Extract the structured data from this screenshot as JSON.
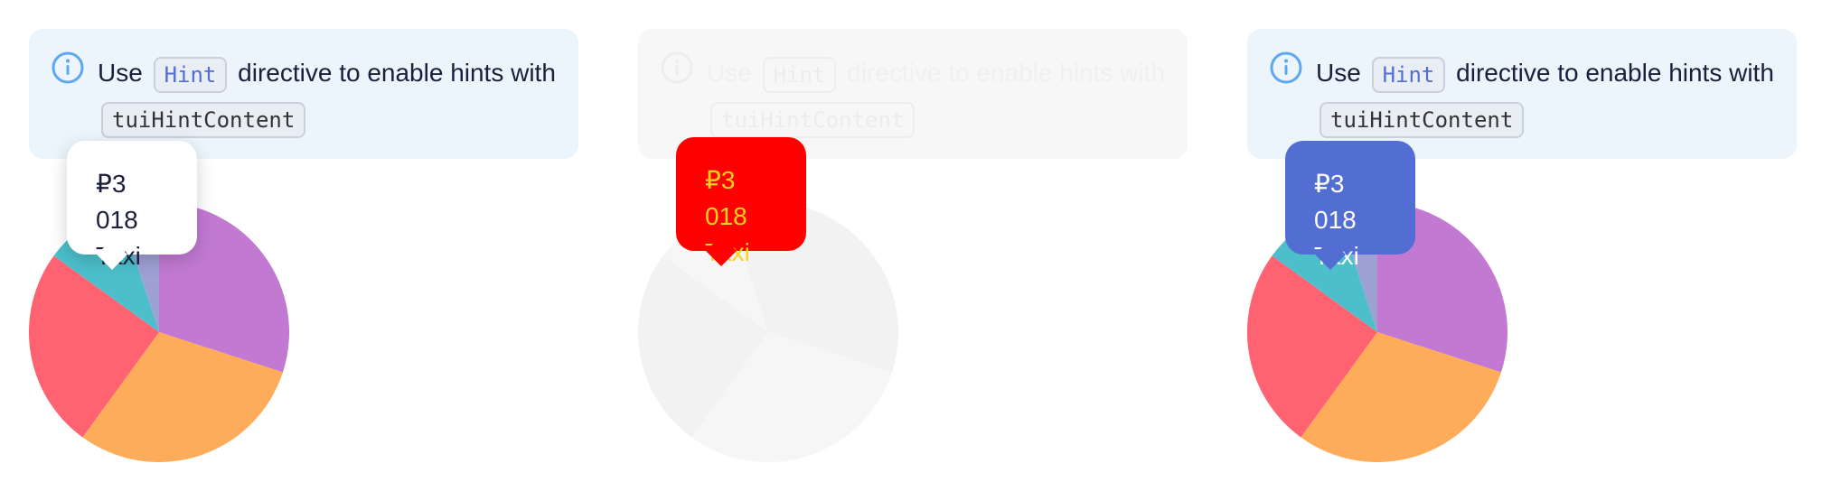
{
  "notice": {
    "prefix": "Use",
    "code1": "Hint",
    "middle": "directive to enable hints with",
    "code2": "tuiHintContent"
  },
  "tooltip": {
    "amount": "₽3 018",
    "label": "Taxi"
  },
  "colors": {
    "purple": "#c279d2",
    "orange": "#feac5a",
    "red": "#ff6270",
    "teal": "#4cbfca",
    "lavender": "#9fa0d4",
    "tooltip_blue": "#526ed3",
    "tooltip_red": "#ff0000"
  },
  "chart_data": {
    "type": "pie",
    "values": [
      30,
      30,
      25,
      10,
      5
    ],
    "colors": [
      "#c279d2",
      "#feac5a",
      "#ff6270",
      "#4cbfca",
      "#9fa0d4"
    ]
  }
}
